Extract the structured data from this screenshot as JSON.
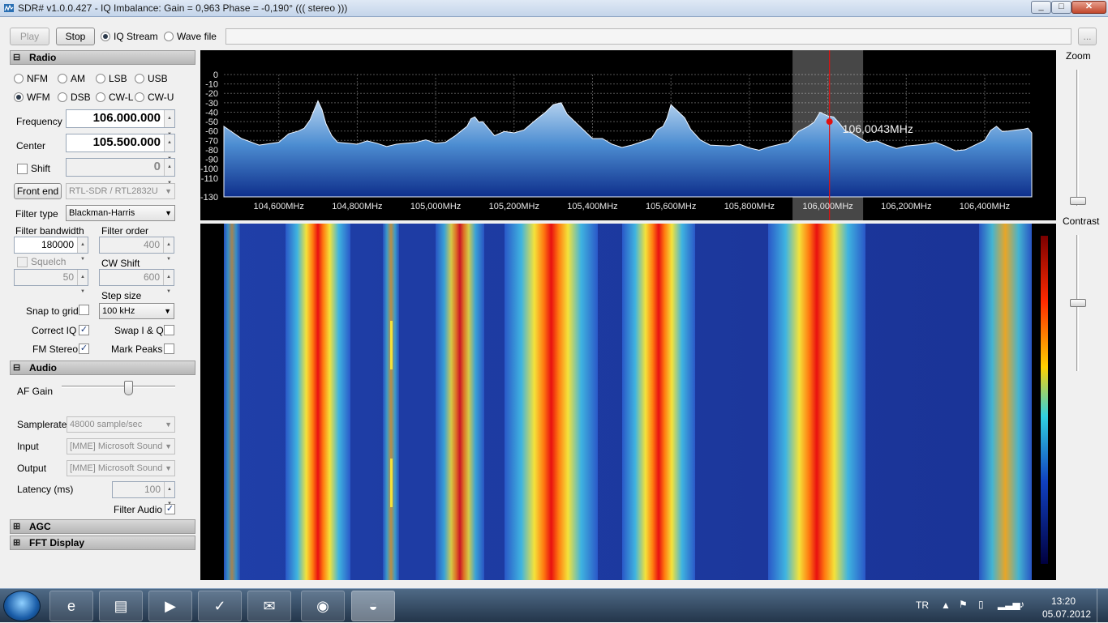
{
  "window": {
    "title": "SDR# v1.0.0.427 - IQ Imbalance: Gain = 0,963 Phase = -0,190° ((( stereo )))"
  },
  "toolbar": {
    "play_label": "Play",
    "stop_label": "Stop",
    "iq_stream_label": "IQ Stream",
    "wave_file_label": "Wave file",
    "browse_label": "...",
    "file_path": ""
  },
  "radio": {
    "header": "Radio",
    "modes": [
      "NFM",
      "AM",
      "LSB",
      "USB",
      "WFM",
      "DSB",
      "CW-L",
      "CW-U"
    ],
    "selected_mode": "WFM",
    "frequency_label": "Frequency",
    "frequency": "106.000.000",
    "center_label": "Center",
    "center": "105.500.000",
    "shift_label": "Shift",
    "shift": "0",
    "front_end_label": "Front end",
    "front_end": "RTL-SDR / RTL2832U",
    "filter_type_label": "Filter type",
    "filter_type": "Blackman-Harris",
    "filter_bandwidth_label": "Filter bandwidth",
    "filter_bandwidth": "180000",
    "filter_order_label": "Filter order",
    "filter_order": "400",
    "squelch_label": "Squelch",
    "squelch": "50",
    "cw_shift_label": "CW Shift",
    "cw_shift": "600",
    "step_size_label": "Step size",
    "step_size": "100 kHz",
    "snap_label": "Snap to grid",
    "correct_iq_label": "Correct IQ",
    "swap_iq_label": "Swap I & Q",
    "fm_stereo_label": "FM Stereo",
    "mark_peaks_label": "Mark Peaks"
  },
  "audio": {
    "header": "Audio",
    "af_gain_label": "AF Gain",
    "af_gain_level": 0.55,
    "samplerate_label": "Samplerate",
    "samplerate": "48000 sample/sec",
    "input_label": "Input",
    "input": "[MME] Microsoft Sound",
    "output_label": "Output",
    "output": "[MME] Microsoft Sound",
    "latency_label": "Latency (ms)",
    "latency": "100",
    "filter_audio_label": "Filter Audio"
  },
  "agc": {
    "header": "AGC"
  },
  "fft": {
    "header": "FFT Display"
  },
  "right": {
    "zoom_label": "Zoom",
    "contrast_label": "Contrast",
    "zoom_level": 0.02,
    "contrast_level": 0.48
  },
  "chart_data": {
    "type": "area",
    "title": "",
    "xlabel": "",
    "ylabel": "",
    "x_ticks": [
      "104,600MHz",
      "104,800MHz",
      "105,000MHz",
      "105,200MHz",
      "105,400MHz",
      "105,600MHz",
      "105,800MHz",
      "106,000MHz",
      "106,200MHz",
      "106,400MHz"
    ],
    "x_tick_values": [
      104.6,
      104.8,
      105.0,
      105.2,
      105.4,
      105.6,
      105.8,
      106.0,
      106.2,
      106.4
    ],
    "y_ticks": [
      "0",
      "-10",
      "-20",
      "-30",
      "-40",
      "-50",
      "-60",
      "-70",
      "-80",
      "-90",
      "-100",
      "-110",
      "-130"
    ],
    "y_tick_values": [
      0,
      -10,
      -20,
      -30,
      -40,
      -50,
      -60,
      -70,
      -80,
      -90,
      -100,
      -110,
      -130
    ],
    "xlim": [
      104.46,
      106.52
    ],
    "ylim": [
      -130,
      0
    ],
    "tuned_label": "106,0043MHz",
    "tuned_mhz": 106.0043,
    "filter_band_mhz": [
      105.91,
      106.09
    ],
    "series": [
      {
        "x": [
          104.46,
          104.55,
          104.6,
          104.65,
          104.68,
          104.7,
          104.72,
          104.75,
          104.8,
          104.85,
          104.9,
          104.95,
          105.0,
          105.05,
          105.08,
          105.1,
          105.12,
          105.15,
          105.2,
          105.25,
          105.28,
          105.32,
          105.35,
          105.4,
          105.45,
          105.5,
          105.55,
          105.58,
          105.6,
          105.62,
          105.65,
          105.7,
          105.75,
          105.8,
          105.85,
          105.9,
          105.95,
          105.98,
          106.0,
          106.03,
          106.06,
          106.1,
          106.15,
          106.2,
          106.25,
          106.3,
          106.35,
          106.4,
          106.43,
          106.46,
          106.5,
          106.52
        ],
        "y": [
          -55,
          -75,
          -72,
          -60,
          -48,
          -28,
          -52,
          -72,
          -74,
          -73,
          -74,
          -72,
          -73,
          -65,
          -55,
          -45,
          -50,
          -65,
          -62,
          -50,
          -40,
          -30,
          -48,
          -68,
          -74,
          -75,
          -68,
          -55,
          -32,
          -40,
          -58,
          -75,
          -76,
          -78,
          -77,
          -72,
          -55,
          -40,
          -44,
          -52,
          -62,
          -72,
          -75,
          -76,
          -74,
          -76,
          -80,
          -70,
          -55,
          -60,
          -58,
          -62
        ]
      }
    ]
  }
}
